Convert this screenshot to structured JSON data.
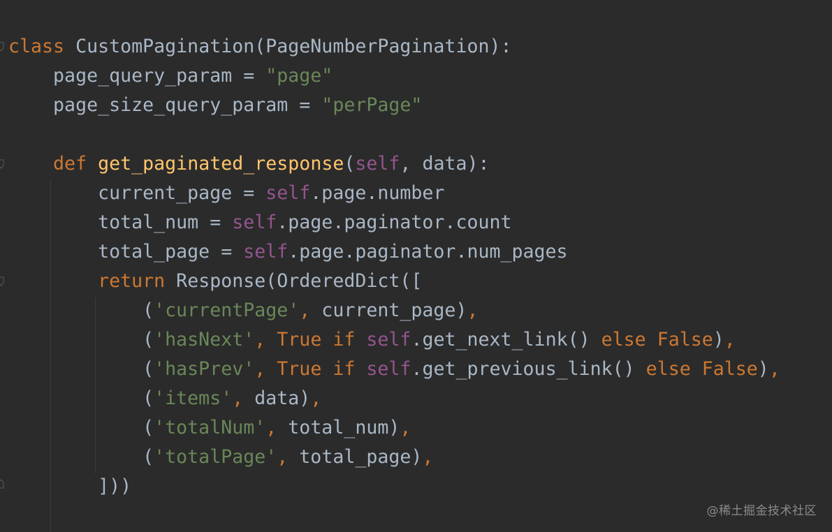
{
  "editor": {
    "background": "#2b2b2b",
    "colors": {
      "keyword": "#cc7832",
      "string": "#6a8759",
      "self": "#94558d",
      "function": "#ffc66d",
      "plain": "#a9b7c6"
    },
    "lines": [
      [
        {
          "t": "class",
          "c": "kw"
        },
        {
          "t": " CustomPagination(PageNumberPagination):",
          "c": "plain"
        }
      ],
      [
        {
          "t": "    page_query_param = ",
          "c": "plain"
        },
        {
          "t": "\"page\"",
          "c": "str"
        }
      ],
      [
        {
          "t": "    page_size_query_param = ",
          "c": "plain"
        },
        {
          "t": "\"perPage\"",
          "c": "str"
        }
      ],
      [],
      [
        {
          "t": "    ",
          "c": "plain"
        },
        {
          "t": "def",
          "c": "kw"
        },
        {
          "t": " ",
          "c": "plain"
        },
        {
          "t": "get_paginated_response",
          "c": "fn"
        },
        {
          "t": "(",
          "c": "plain"
        },
        {
          "t": "self",
          "c": "self"
        },
        {
          "t": ", data):",
          "c": "plain"
        }
      ],
      [
        {
          "t": "        current_page = ",
          "c": "plain"
        },
        {
          "t": "self",
          "c": "self"
        },
        {
          "t": ".page.number",
          "c": "plain"
        }
      ],
      [
        {
          "t": "        total_num = ",
          "c": "plain"
        },
        {
          "t": "self",
          "c": "self"
        },
        {
          "t": ".page.paginator.count",
          "c": "plain"
        }
      ],
      [
        {
          "t": "        total_page = ",
          "c": "plain"
        },
        {
          "t": "self",
          "c": "self"
        },
        {
          "t": ".page.paginator.num_pages",
          "c": "plain"
        }
      ],
      [
        {
          "t": "        ",
          "c": "plain"
        },
        {
          "t": "return",
          "c": "kw"
        },
        {
          "t": " Response(OrderedDict([",
          "c": "plain"
        }
      ],
      [
        {
          "t": "            (",
          "c": "plain"
        },
        {
          "t": "'currentPage'",
          "c": "str"
        },
        {
          "t": ",",
          "c": "kw"
        },
        {
          "t": " current_page)",
          "c": "plain"
        },
        {
          "t": ",",
          "c": "kw"
        }
      ],
      [
        {
          "t": "            (",
          "c": "plain"
        },
        {
          "t": "'hasNext'",
          "c": "str"
        },
        {
          "t": ",",
          "c": "kw"
        },
        {
          "t": " ",
          "c": "plain"
        },
        {
          "t": "True",
          "c": "kw"
        },
        {
          "t": " ",
          "c": "plain"
        },
        {
          "t": "if",
          "c": "kw"
        },
        {
          "t": " ",
          "c": "plain"
        },
        {
          "t": "self",
          "c": "self"
        },
        {
          "t": ".get_next_link() ",
          "c": "plain"
        },
        {
          "t": "else",
          "c": "kw"
        },
        {
          "t": " ",
          "c": "plain"
        },
        {
          "t": "False",
          "c": "kw"
        },
        {
          "t": ")",
          "c": "plain"
        },
        {
          "t": ",",
          "c": "kw"
        }
      ],
      [
        {
          "t": "            (",
          "c": "plain"
        },
        {
          "t": "'hasPrev'",
          "c": "str"
        },
        {
          "t": ",",
          "c": "kw"
        },
        {
          "t": " ",
          "c": "plain"
        },
        {
          "t": "True",
          "c": "kw"
        },
        {
          "t": " ",
          "c": "plain"
        },
        {
          "t": "if",
          "c": "kw"
        },
        {
          "t": " ",
          "c": "plain"
        },
        {
          "t": "self",
          "c": "self"
        },
        {
          "t": ".get_previous_link() ",
          "c": "plain"
        },
        {
          "t": "else",
          "c": "kw"
        },
        {
          "t": " ",
          "c": "plain"
        },
        {
          "t": "False",
          "c": "kw"
        },
        {
          "t": ")",
          "c": "plain"
        },
        {
          "t": ",",
          "c": "kw"
        }
      ],
      [
        {
          "t": "            (",
          "c": "plain"
        },
        {
          "t": "'items'",
          "c": "str"
        },
        {
          "t": ",",
          "c": "kw"
        },
        {
          "t": " data)",
          "c": "plain"
        },
        {
          "t": ",",
          "c": "kw"
        }
      ],
      [
        {
          "t": "            (",
          "c": "plain"
        },
        {
          "t": "'totalNum'",
          "c": "str"
        },
        {
          "t": ",",
          "c": "kw"
        },
        {
          "t": " total_num)",
          "c": "plain"
        },
        {
          "t": ",",
          "c": "kw"
        }
      ],
      [
        {
          "t": "            (",
          "c": "plain"
        },
        {
          "t": "'totalPage'",
          "c": "str"
        },
        {
          "t": ",",
          "c": "kw"
        },
        {
          "t": " total_page)",
          "c": "plain"
        },
        {
          "t": ",",
          "c": "kw"
        }
      ],
      [
        {
          "t": "        ]))",
          "c": "plain"
        }
      ]
    ]
  },
  "watermark": {
    "text": "@稀土掘金技术社区"
  }
}
